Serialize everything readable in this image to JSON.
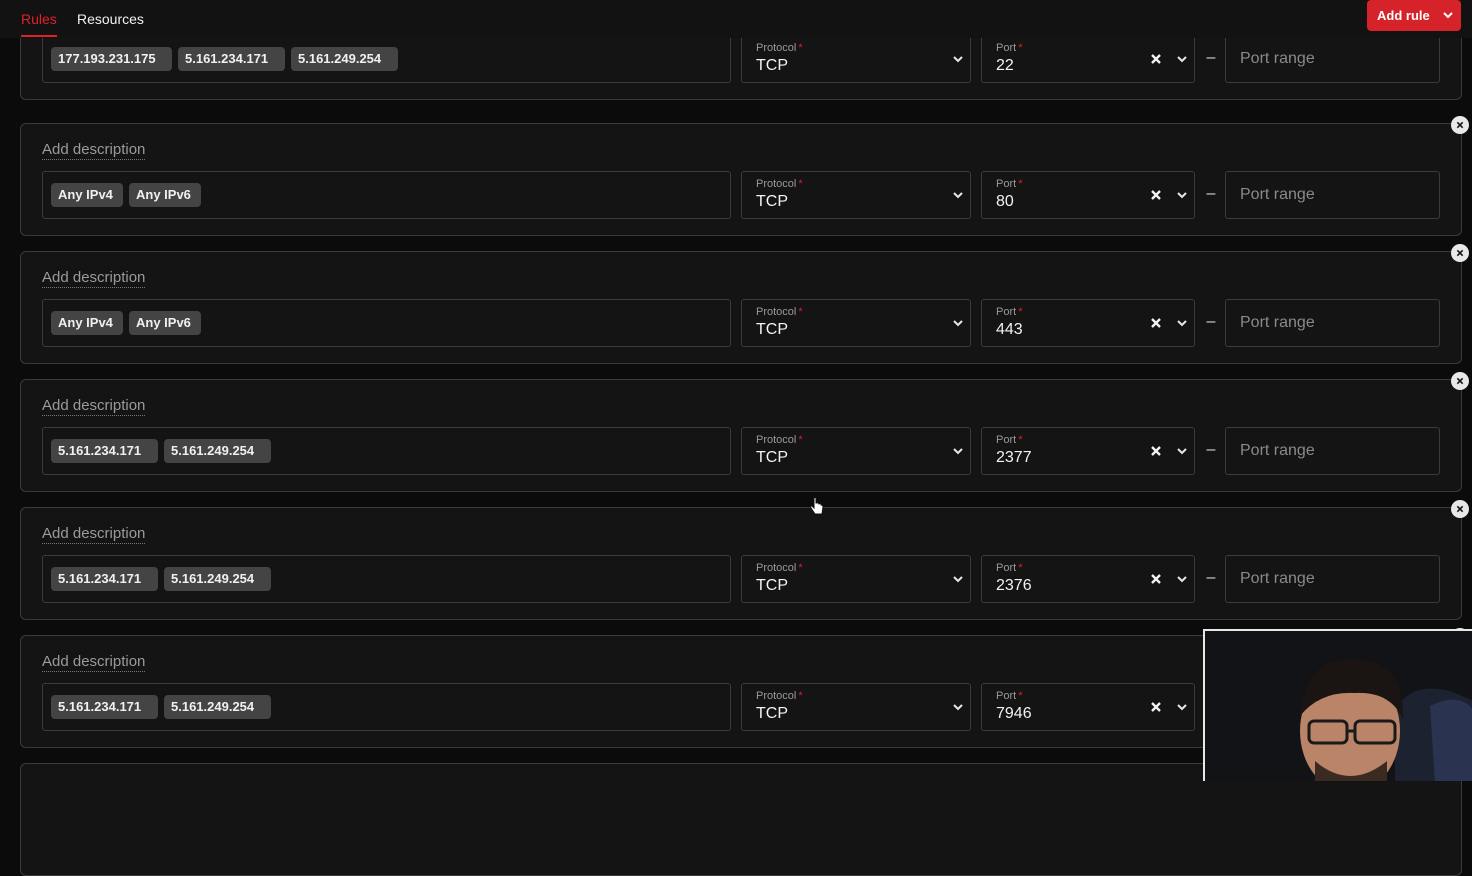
{
  "tabs": [
    {
      "label": "Rules",
      "active": true
    },
    {
      "label": "Resources",
      "active": false
    }
  ],
  "add_rule_label": "Add rule",
  "colors": {
    "accent": "#d62229",
    "background": "#0b0b0b",
    "card": "#141414"
  },
  "rule_defaults": {
    "description_placeholder": "Add description",
    "protocol_label": "Protocol",
    "port_label": "Port",
    "required_mark": "*",
    "port_range_placeholder": "Port range",
    "range_separator": "–"
  },
  "rules": [
    {
      "description": null,
      "sources": [
        "177.193.231.175",
        "5.161.234.171",
        "5.161.249.254"
      ],
      "protocol": "TCP",
      "port": "22",
      "has_range": true
    },
    {
      "description": "Add description",
      "sources": [
        "Any IPv4",
        "Any IPv6"
      ],
      "protocol": "TCP",
      "port": "80",
      "has_range": true
    },
    {
      "description": "Add description",
      "sources": [
        "Any IPv4",
        "Any IPv6"
      ],
      "protocol": "TCP",
      "port": "443",
      "has_range": true
    },
    {
      "description": "Add description",
      "sources": [
        "5.161.234.171",
        "5.161.249.254"
      ],
      "protocol": "TCP",
      "port": "2377",
      "has_range": true
    },
    {
      "description": "Add description",
      "sources": [
        "5.161.234.171",
        "5.161.249.254"
      ],
      "protocol": "TCP",
      "port": "2376",
      "has_range": true
    },
    {
      "description": "Add description",
      "sources": [
        "5.161.234.171",
        "5.161.249.254"
      ],
      "protocol": "TCP",
      "port": "7946",
      "has_range": false
    }
  ],
  "icons": {
    "remove": "close-circle-icon",
    "chevron": "chevron-down-icon",
    "clear": "close-icon"
  }
}
